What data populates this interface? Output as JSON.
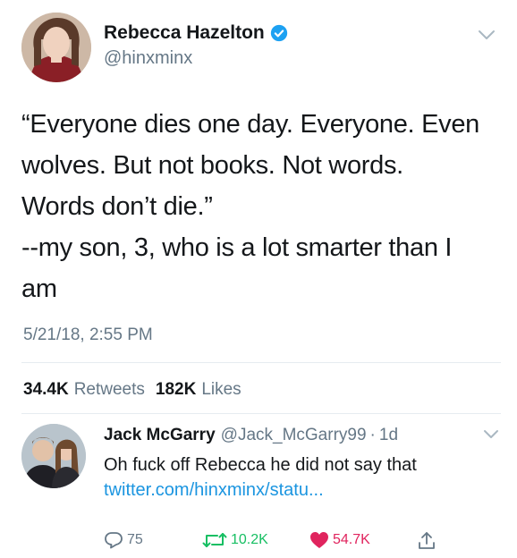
{
  "tweet": {
    "author_name": "Rebecca Hazelton",
    "author_handle": "@hinxminx",
    "text_lines": [
      "“Everyone dies one day. Everyone. Even",
      "wolves. But not books. Not words.",
      "Words don’t die.”",
      "--my son, 3, who is a lot smarter than I",
      "am"
    ],
    "timestamp": "5/21/18, 2:55 PM",
    "retweets_count": "34.4K",
    "retweets_label": "Retweets",
    "likes_count": "182K",
    "likes_label": "Likes"
  },
  "reply": {
    "author_name": "Jack McGarry",
    "author_handle": "@Jack_McGarry99",
    "separator": "·",
    "time": "1d",
    "text": "Oh fuck off Rebecca he did not say that",
    "link": "twitter.com/hinxminx/statu...",
    "reply_count": "75",
    "retweet_count": "10.2K",
    "like_count": "54.7K"
  },
  "icons": {
    "verified": "verified-badge-icon",
    "menu": "chevron-down-icon",
    "reply": "reply-icon",
    "retweet": "retweet-icon",
    "like": "heart-icon",
    "share": "share-icon"
  },
  "colors": {
    "text": "#14171a",
    "secondary": "#657786",
    "link": "#1b95e0",
    "verified": "#1da1f2",
    "retweet": "#17bf63",
    "like": "#e0245e"
  }
}
